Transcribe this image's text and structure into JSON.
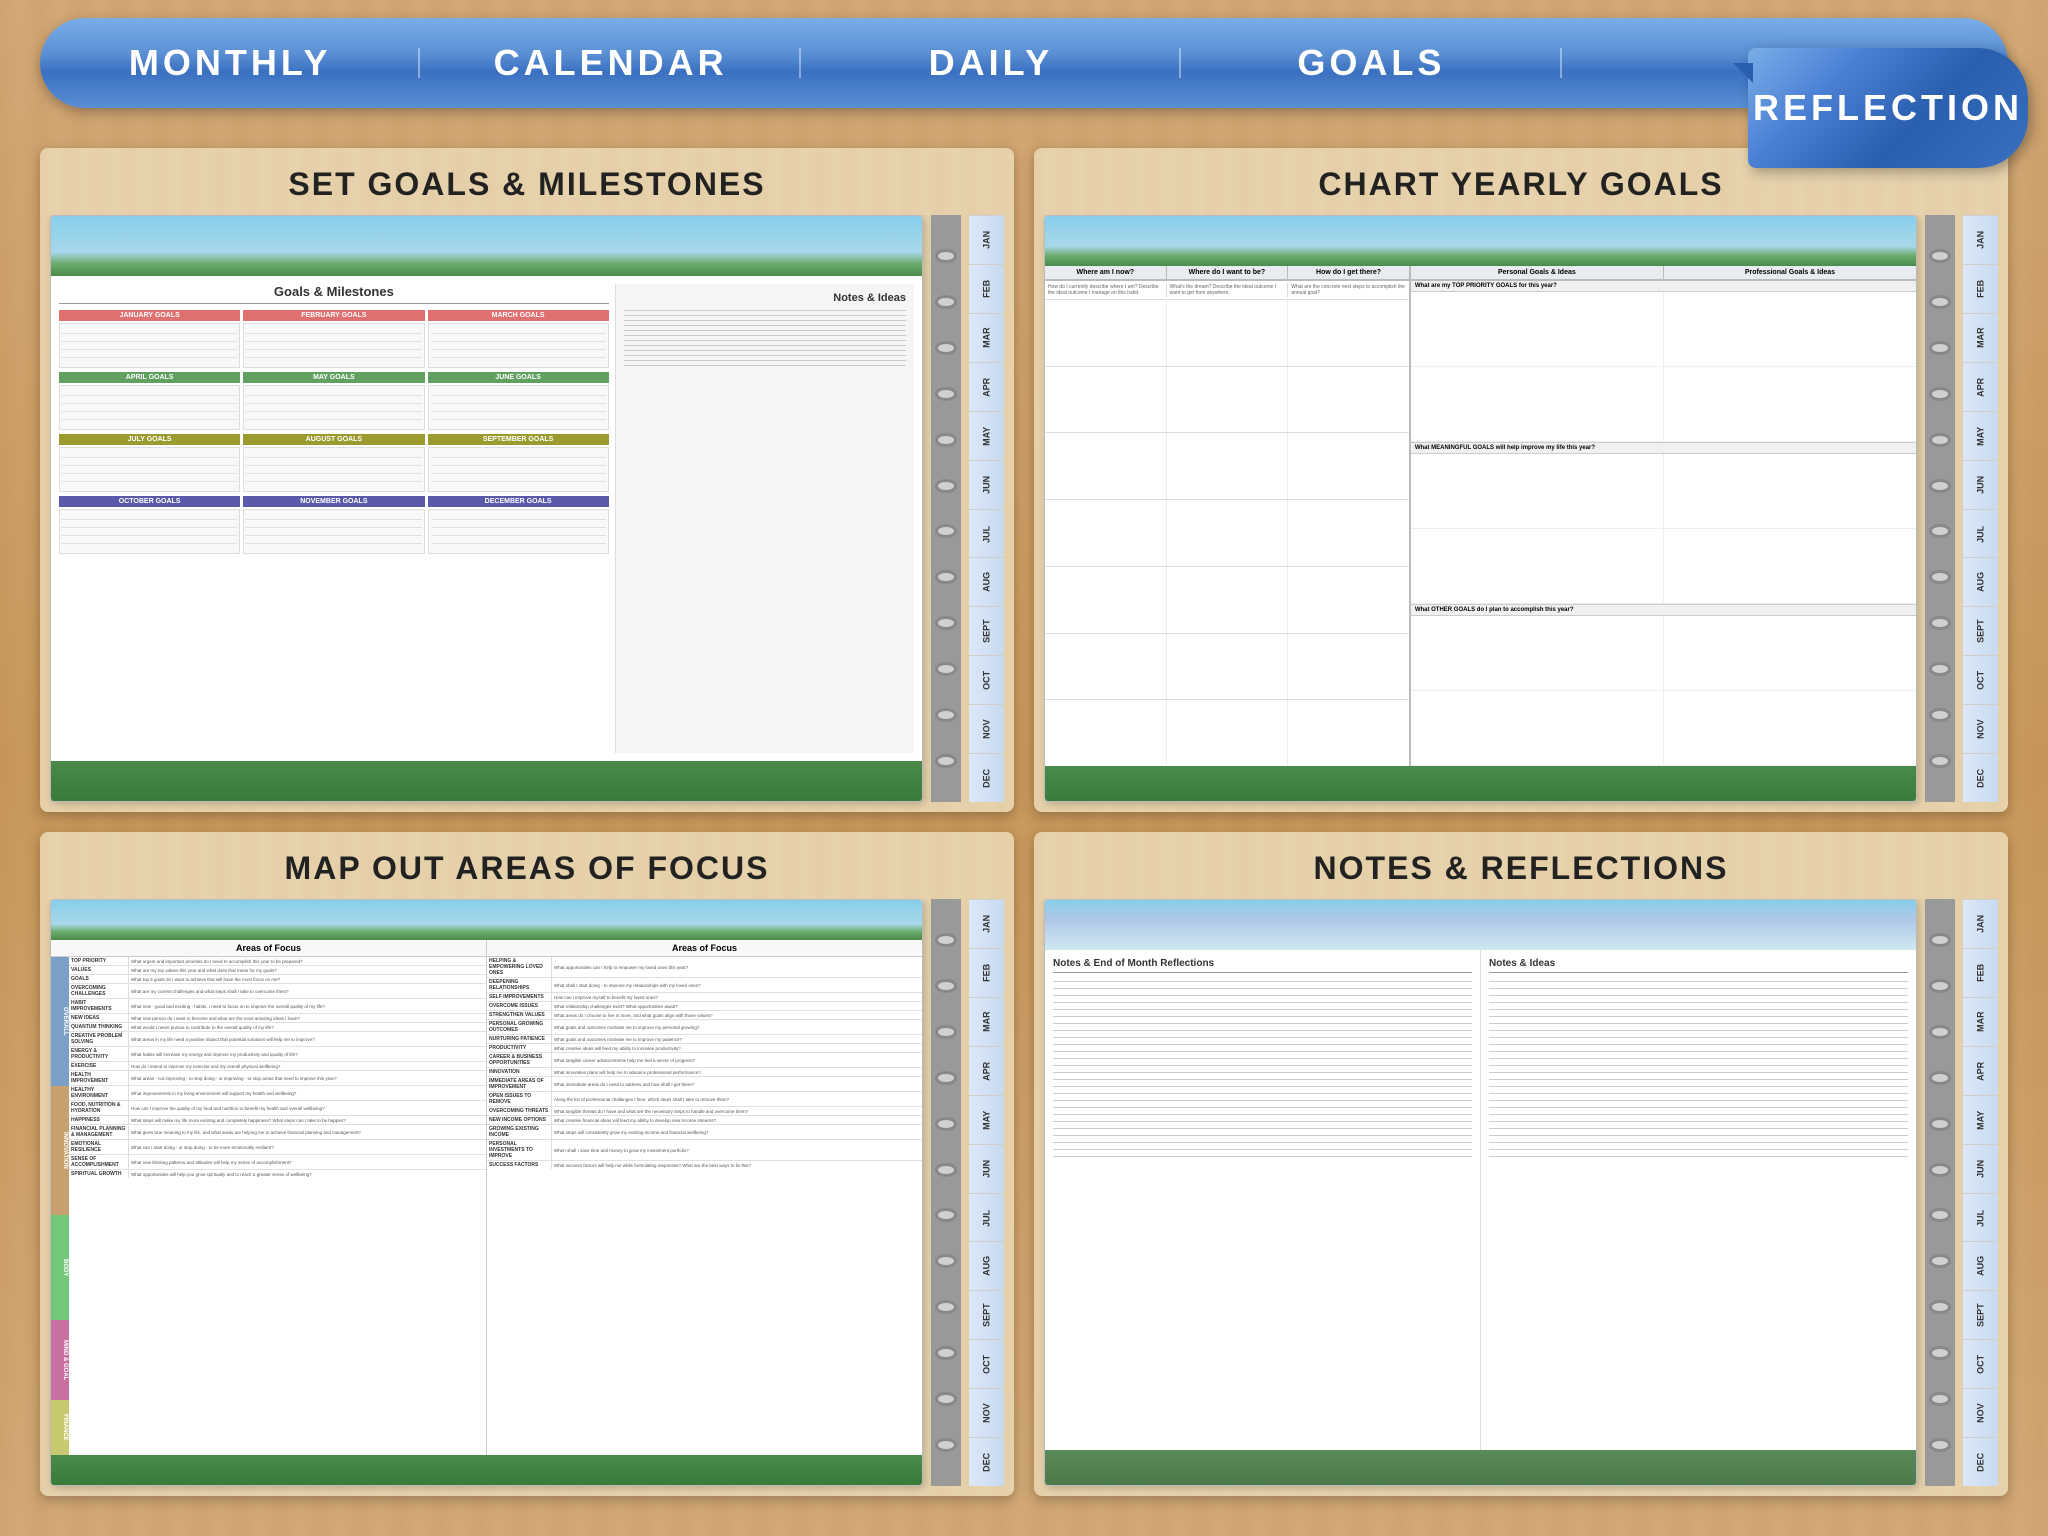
{
  "nav": {
    "items": [
      {
        "id": "monthly",
        "label": "MONTHLY",
        "active": false
      },
      {
        "id": "calendar",
        "label": "CALENDAR",
        "active": false
      },
      {
        "id": "daily",
        "label": "DAILY",
        "active": false
      },
      {
        "id": "goals",
        "label": "GOALS",
        "active": false
      },
      {
        "id": "reflection",
        "label": "REFLECTION",
        "active": true
      }
    ]
  },
  "panels": {
    "top_left": {
      "title": "SET GOALS & MILESTONES",
      "notebook_title": "Goals & Milestones",
      "notes_title": "Notes & Ideas",
      "months": {
        "q1": [
          "JANUARY GOALS",
          "FEBRUARY GOALS",
          "MARCH GOALS"
        ],
        "q2": [
          "APRIL GOALS",
          "MAY GOALS",
          "JUNE GOALS"
        ],
        "q3": [
          "JULY GOALS",
          "AUGUST GOALS",
          "SEPTEMBER GOALS"
        ],
        "q4": [
          "OCTOBER GOALS",
          "NOVEMBER GOALS",
          "DECEMBER GOALS"
        ]
      },
      "month_tabs": [
        "JAN",
        "FEB",
        "MAR",
        "APR",
        "MAY",
        "JUN",
        "JUL",
        "AUG",
        "SEPT",
        "OCT",
        "NOV",
        "DEC"
      ]
    },
    "top_right": {
      "title": "CHART YEARLY GOALS",
      "questions": [
        {
          "title": "Where am I now?",
          "text": "How do I currently describe where I am? Describe the ideal outcome I'd manage on this habit."
        },
        {
          "title": "Where do I want to be?",
          "text": "What's the dream? Describe the ideal outcome I want to get there from anywhere."
        },
        {
          "title": "How do I get there?",
          "text": "What are the concrete next steps I need to accomplish this annual goal?"
        }
      ],
      "columns": [
        "Personal Goals & Ideas",
        "Professional Goals & Ideas"
      ],
      "sections": [
        "What are my TOP PRIORITY GOALS for this year?",
        "What MEANINGFUL GOALS will help improve my life this year?",
        "What OTHER GOALS do I plan to accomplish this year?"
      ],
      "month_tabs": [
        "JAN",
        "FEB",
        "MAR",
        "APR",
        "MAY",
        "JUN",
        "JUL",
        "AUG",
        "SEPT",
        "OCT",
        "NOV",
        "DEC"
      ]
    },
    "bottom_left": {
      "title": "MAP OUT AREAS OF FOCUS",
      "left_title": "Areas of Focus",
      "right_title": "Areas of Focus",
      "categories": {
        "overall": [
          "TOP PRIORITY",
          "VALUES",
          "GOALS",
          "OVERCOMING CHALLENGES",
          "HABIT IMPROVEMENTS"
        ],
        "innovation": [
          "NEW IDEAS",
          "QUANTUM THINKING",
          "CREATIVE PROBLEM SOLVING",
          "ENERGY & PRODUCTIVITY",
          "EXERCISE"
        ],
        "body": [
          "HEALTH IMPROVEMENT",
          "HEALTHY ENVIRONMENT",
          "FOOD, NUTRITION & HYDRATION",
          "HAPPINESS"
        ],
        "mindgoal": [
          "EMOTIONAL RESILIENCE",
          "SENSE OF ACCOMPLISHMENT",
          "SPIRITUAL GROWTH"
        ],
        "finance": []
      },
      "month_tabs": [
        "JAN",
        "FEB",
        "MAR",
        "APR",
        "MAY",
        "JUN",
        "JUL",
        "AUG",
        "SEPT",
        "OCT",
        "NOV",
        "DEC"
      ]
    },
    "bottom_right": {
      "title": "NOTES & REFLECTIONS",
      "left_section_title": "Notes & End of Month Reflections",
      "right_section_title": "Notes & Ideas",
      "month_tabs": [
        "JAN",
        "FEB",
        "MAR",
        "APR",
        "MAY",
        "JUN",
        "JUL",
        "AUG",
        "SEPT",
        "OCT",
        "NOV",
        "DEC"
      ]
    }
  }
}
